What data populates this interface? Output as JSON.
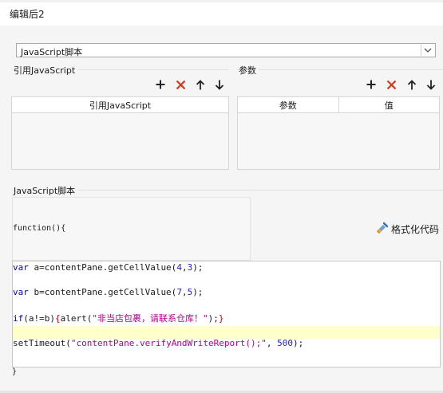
{
  "window": {
    "title": "编辑后2"
  },
  "script_type": {
    "selected": "JavaScript脚本"
  },
  "ref_js": {
    "section_label": "引用JavaScript",
    "column_header": "引用JavaScript"
  },
  "params": {
    "section_label": "参数",
    "columns": [
      "参数",
      "值"
    ]
  },
  "js_script": {
    "section_label": "JavaScript脚本",
    "function_open": "function(){",
    "format_button": "格式化代码",
    "closing_brace": "}",
    "code": [
      {
        "kw": "var",
        "rest": " a=contentPane.getCellValue(",
        "n1": "4",
        "comma": ",",
        "n2": "3",
        "end": ");"
      },
      {
        "kw": "var",
        "rest": " b=contentPane.getCellValue(",
        "n1": "7",
        "comma": ",",
        "n2": "5",
        "end": ");"
      },
      {
        "kw": "if",
        "cond": "(a!=b)",
        "brace_open": "{",
        "fn": "alert(",
        "str": "\"非当店包裹，请联系仓库！\"",
        "end": ");",
        "brace_close": "}"
      },
      {
        "fn": "setTimeout(",
        "str": "\"contentPane.verifyAndWriteReport();\"",
        "mid": ", ",
        "num": "500",
        "end": ");"
      }
    ]
  },
  "colors": {
    "delete_icon": "#e0301e",
    "keyword": "#0000c0",
    "string": "#b5008a",
    "highlight_line": "#ffffcc"
  },
  "icons": [
    "plus-icon",
    "delete-x-icon",
    "arrow-up-icon",
    "arrow-down-icon",
    "broom-icon",
    "chevron-down-icon"
  ]
}
